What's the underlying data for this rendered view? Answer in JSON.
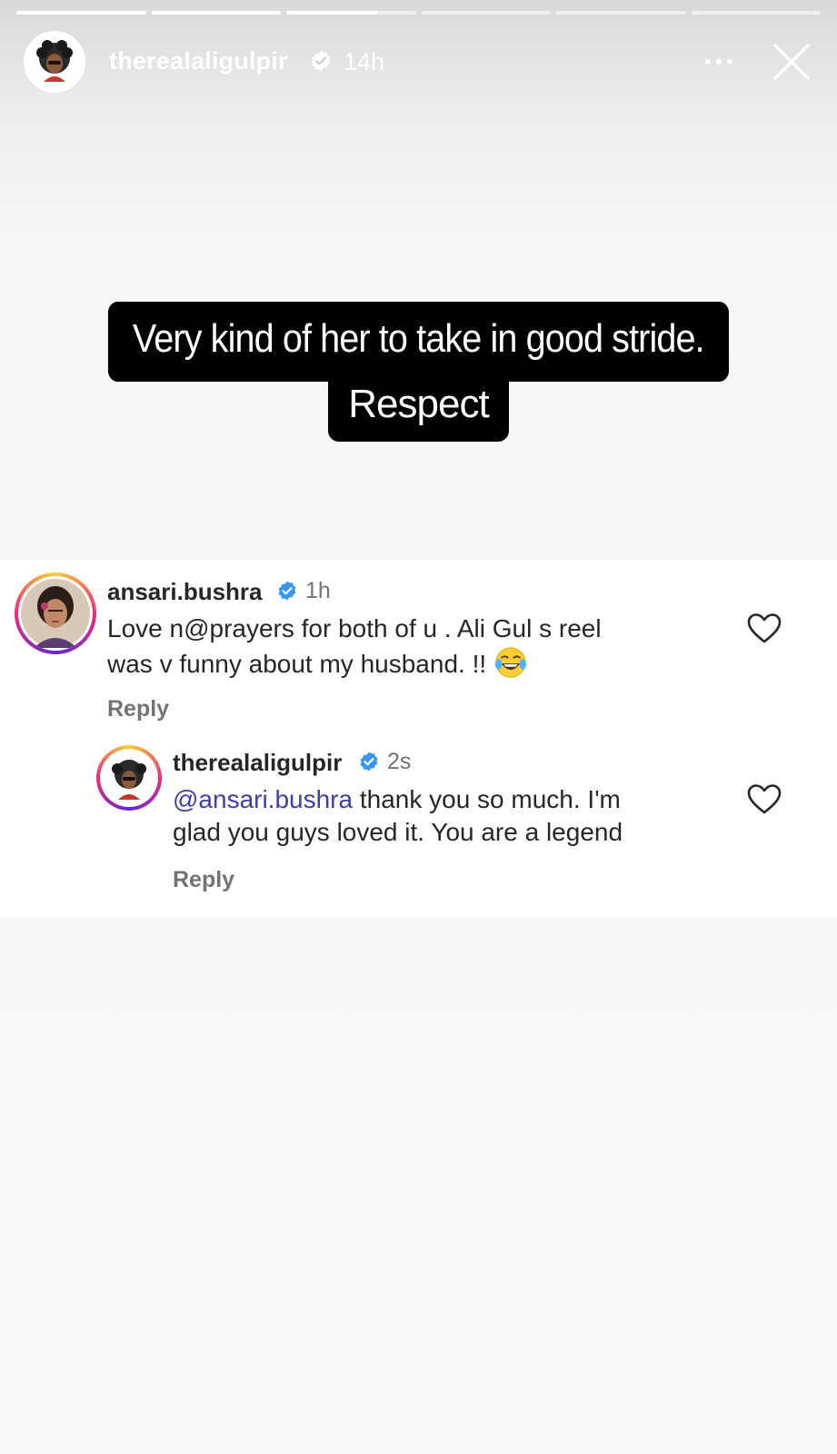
{
  "story": {
    "progress_segments": [
      1,
      1,
      0.7,
      0,
      0,
      0
    ],
    "username": "therealaligulpir",
    "time": "14h",
    "caption_line1": "Very kind of her to take in good stride.",
    "caption_line2": "Respect"
  },
  "comment": {
    "username": "ansari.bushra",
    "time": "1h",
    "text_line1": "Love n@prayers for both of u . Ali Gul s reel",
    "text_line2": "was v funny  about my husband. !!",
    "reply_label": "Reply"
  },
  "reply": {
    "username": "therealaligulpir",
    "time": "2s",
    "mention": "@ansari.bushra",
    "text_line1_rest": " thank you so much. I'm",
    "text_line2": "glad you guys loved it. You are a legend",
    "reply_label": "Reply"
  },
  "colors": {
    "verified": "#3897f0",
    "mention": "#3b3fa6",
    "secondary_text": "#737373"
  }
}
